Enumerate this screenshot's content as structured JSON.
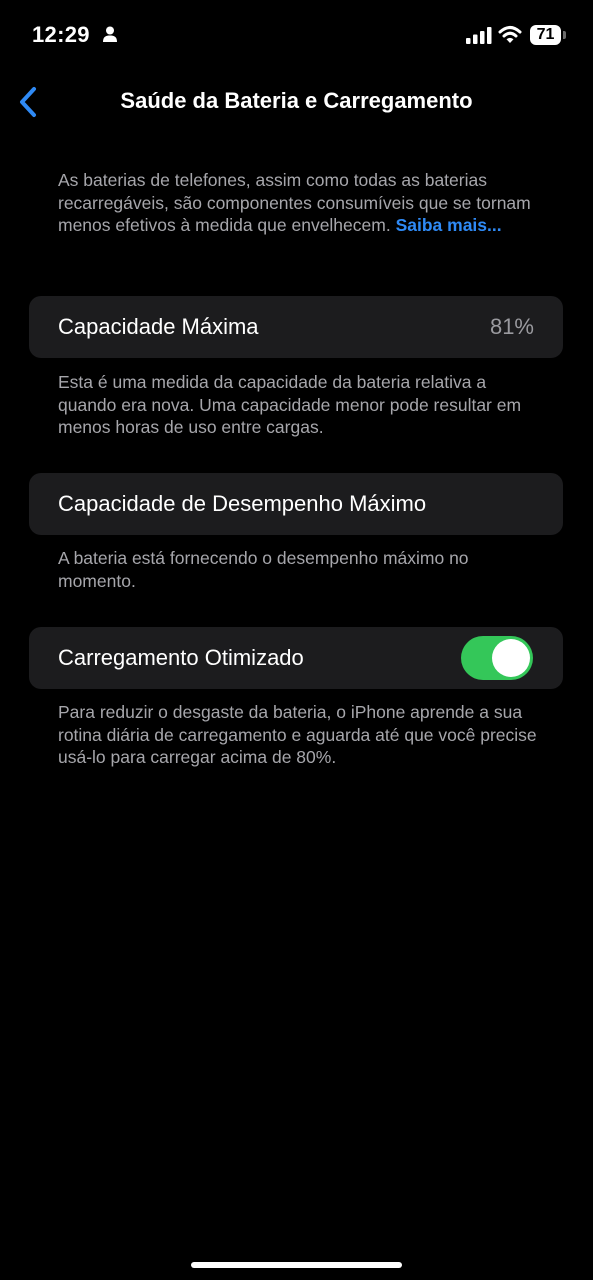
{
  "status_bar": {
    "time": "12:29",
    "battery_level": "71"
  },
  "nav": {
    "title": "Saúde da Bateria e Carregamento"
  },
  "intro": {
    "text": "As baterias de telefones, assim como todas as baterias recarregáveis, são componentes consumíveis que se tornam menos efetivos à medida que envelhecem.",
    "link": "Saiba mais..."
  },
  "max_capacity": {
    "label": "Capacidade Máxima",
    "value": "81%",
    "footer": "Esta é uma medida da capacidade da bateria relativa a quando era nova. Uma capacidade menor pode resultar em menos horas de uso entre cargas."
  },
  "peak_performance": {
    "label": "Capacidade de Desempenho Máximo",
    "footer": "A bateria está fornecendo o desempenho máximo no momento."
  },
  "optimized_charging": {
    "label": "Carregamento Otimizado",
    "enabled": true,
    "footer": "Para reduzir o desgaste da bateria, o iPhone aprende a sua rotina diária de carregamento e aguarda até que você precise usá-lo para carregar acima de 80%."
  },
  "colors": {
    "background": "#000000",
    "card": "#1c1c1e",
    "secondary_text": "#a6a6ab",
    "link": "#2f8af5",
    "toggle_on": "#34c759"
  },
  "icons": {
    "back": "chevron-left-icon",
    "person": "person-icon",
    "signal": "cellular-signal-icon",
    "wifi": "wifi-icon",
    "battery": "battery-icon"
  }
}
